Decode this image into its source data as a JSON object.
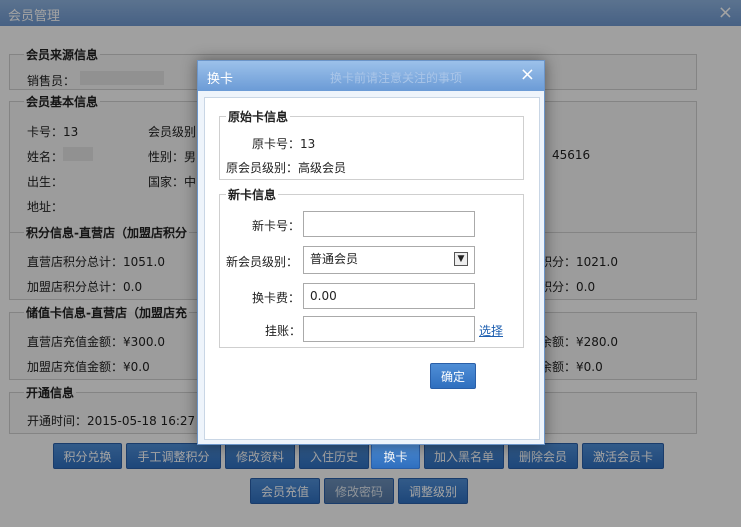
{
  "window": {
    "title": "会员管理",
    "close_icon": "×"
  },
  "source_info": {
    "legend": "会员来源信息",
    "salesperson_label": "销售员："
  },
  "basic_info": {
    "legend": "会员基本信息",
    "card_no_label": "卡号：13",
    "level_label": "会员级别",
    "name_label": "姓名：",
    "gender_label": "性别：男",
    "birth_label": "出生：",
    "country_label": "国家：中",
    "address_label": "地址：",
    "right_value": "45616"
  },
  "points_info": {
    "legend": "积分信息-直营店（加盟店积分",
    "direct_total": "直营店积分总计：1051.0",
    "franchise_total": "加盟店积分总计：0.0",
    "right_1": "积分：1021.0",
    "right_2": "积分：0.0"
  },
  "stored_info": {
    "legend": "储值卡信息-直营店（加盟店充",
    "direct_total": "直营店充值金额：¥300.0",
    "franchise_total": "加盟店充值金额：¥0.0",
    "right_1": "余额：¥280.0",
    "right_2": "余额：¥0.0"
  },
  "open_info": {
    "legend": "开通信息",
    "open_time": "开通时间：2015-05-18 16:27"
  },
  "bottom_buttons": {
    "row1": [
      "积分兑换",
      "手工调整积分",
      "修改资料",
      "入住历史",
      "换卡",
      "加入黑名单",
      "删除会员",
      "激活会员卡"
    ],
    "row2": [
      "会员充值",
      "修改密码",
      "调整级别"
    ]
  },
  "dialog": {
    "title": "换卡",
    "ghost_title": "换卡前请注意关注的事项",
    "close_icon": "×",
    "original": {
      "legend": "原始卡信息",
      "card_no": "原卡号：13",
      "level": "原会员级别：高级会员"
    },
    "new": {
      "legend": "新卡信息",
      "card_no_label": "新卡号：",
      "card_no_value": "",
      "level_label": "新会员级别：",
      "level_selected": "普通会员",
      "fee_label": "换卡费：",
      "fee_value": "0.00",
      "account_label": "挂账：",
      "account_value": "",
      "select_link": "选择"
    },
    "confirm": "确定"
  },
  "colors": {
    "accent": "#2f6fbf",
    "highlight": "#e23d3d",
    "link": "#1e5fb0"
  }
}
